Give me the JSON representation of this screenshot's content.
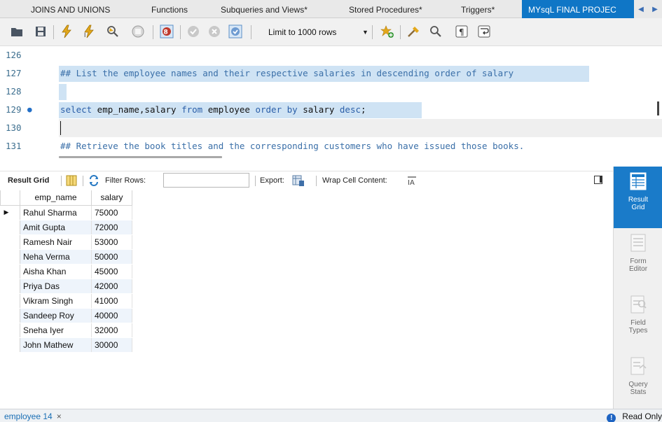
{
  "tabs": [
    {
      "label": "JOINS AND UNIONS"
    },
    {
      "label": "Functions"
    },
    {
      "label": "Subqueries and Views*"
    },
    {
      "label": "Stored Procedures*"
    },
    {
      "label": "Triggers*"
    },
    {
      "label": "MYsqL FINAL PROJEC"
    }
  ],
  "toolbar": {
    "limit_label": "Limit to 1000 rows",
    "icons": [
      "open-folder-icon",
      "save-icon",
      "execute-icon",
      "execute-current-icon",
      "explain-icon",
      "stop-icon",
      "toggle-error-icon",
      "commit-icon",
      "rollback-icon",
      "autocommit-icon",
      "add-snippet-icon",
      "beautify-icon",
      "find-icon",
      "invisible-chars-icon",
      "word-wrap-icon"
    ]
  },
  "editor": {
    "lines": [
      {
        "num": "126",
        "text": ""
      },
      {
        "num": "127",
        "text": "## List the employee names and their respective salaries in descending order of salary"
      },
      {
        "num": "128",
        "text": ""
      },
      {
        "num": "129",
        "text": "select emp_name,salary from employee order by salary desc;"
      },
      {
        "num": "130",
        "text": ""
      },
      {
        "num": "131",
        "text": "## Retrieve the book titles and the corresponding customers who have issued those books."
      }
    ],
    "sql_parts": {
      "k1": "select",
      "p1": " emp_name,salary ",
      "k2": "from",
      "p2": " employee ",
      "k3": "order by",
      "p3": " salary ",
      "k4": "desc",
      "p4": ";"
    }
  },
  "result_bar": {
    "result_grid_label": "Result Grid",
    "filter_label": "Filter Rows:",
    "filter_value": "",
    "export_label": "Export:",
    "wrap_label": "Wrap Cell Content:"
  },
  "grid": {
    "columns": [
      "emp_name",
      "salary"
    ],
    "rows": [
      [
        "Rahul Sharma",
        "75000"
      ],
      [
        "Amit Gupta",
        "72000"
      ],
      [
        "Ramesh Nair",
        "53000"
      ],
      [
        "Neha Verma",
        "50000"
      ],
      [
        "Aisha Khan",
        "45000"
      ],
      [
        "Priya Das",
        "42000"
      ],
      [
        "Vikram Singh",
        "41000"
      ],
      [
        "Sandeep Roy",
        "40000"
      ],
      [
        "Sneha Iyer",
        "32000"
      ],
      [
        "John Mathew",
        "30000"
      ]
    ]
  },
  "side_panel": [
    {
      "label1": "Result",
      "label2": "Grid",
      "icon": "result-grid-icon"
    },
    {
      "label1": "Form",
      "label2": "Editor",
      "icon": "form-editor-icon"
    },
    {
      "label1": "Field",
      "label2": "Types",
      "icon": "field-types-icon"
    },
    {
      "label1": "Query",
      "label2": "Stats",
      "icon": "query-stats-icon"
    }
  ],
  "bottom": {
    "tab_label": "employee 14",
    "close": "×",
    "status": "Read Only"
  },
  "colors": {
    "accent": "#0f76c6",
    "selection": "#cfe3f4",
    "keyword": "#2a5ea8"
  }
}
